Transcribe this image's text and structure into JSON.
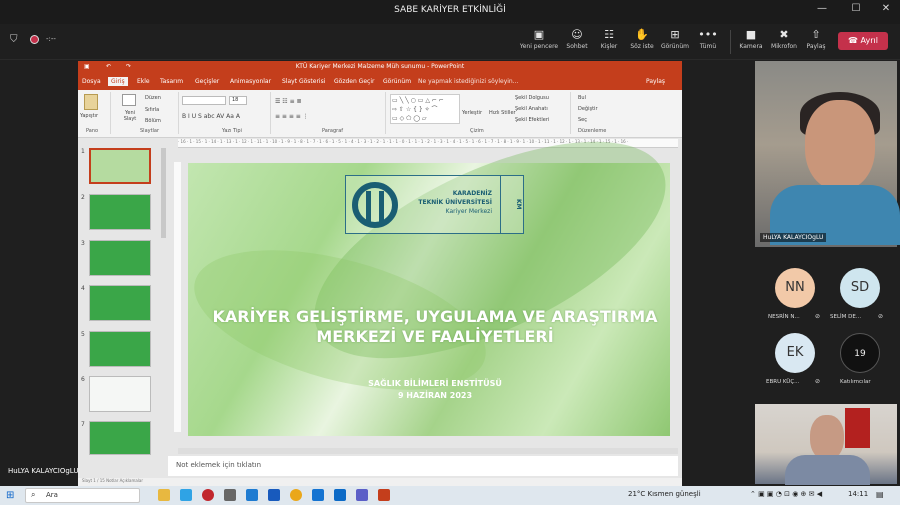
{
  "teams": {
    "window_title": "SABE KARİYER ETKİNLİĞİ",
    "timer": "-:--",
    "toolbar": {
      "new_window": "Yeni pencere",
      "chat": "Sohbet",
      "people": "Kişler",
      "raise": "Söz iste",
      "view": "Görünüm",
      "more": "Tümü",
      "camera": "Kamera",
      "mic": "Mikrofon",
      "share": "Paylaş",
      "leave": "Ayrıl"
    },
    "icons": {
      "new_window": "▣",
      "chat": "☺",
      "people": "☷",
      "raise": "✋",
      "view": "⊞",
      "more": "•••",
      "camera": "■",
      "mic": "✖",
      "share": "⇧",
      "phone": "☎"
    },
    "presenter_label": "HuLYA KALAYCIOgLU"
  },
  "powerpoint": {
    "title": "KTÜ Kariyer Merkezi Malzeme Müh sunumu - PowerPoint",
    "tabs": [
      "Dosya",
      "Giriş",
      "Ekle",
      "Tasarım",
      "Geçişler",
      "Animasyonlar",
      "Slayt Gösterisi",
      "Gözden Geçir",
      "Görünüm"
    ],
    "tell_me": "Ne yapmak istediğinizi söyleyin...",
    "share": "Paylaş",
    "ribbon": {
      "paste": "Yapıştır",
      "new_slide": "Yeni Slayt",
      "layout": "Düzen",
      "reset": "Sıfırla",
      "section": "Bölüm",
      "font_size": "18",
      "arrange": "Yerleştir",
      "quick_styles": "Hızlı Stiller",
      "shape_fill": "Şekil Dolgusu",
      "shape_outline": "Şekil Anahatı",
      "shape_effects": "Şekil Efektleri",
      "find": "Bul",
      "replace": "Değiştir",
      "select": "Seç",
      "groups": [
        "Pano",
        "Slaytlar",
        "Yazı Tipi",
        "Paragraf",
        "Çizim",
        "Düzenleme"
      ]
    },
    "ruler": "· 16 · 1 · 15 · 1 · 14 · 1 · 13 · 1 · 12 · 1 · 11 · 1 · 10 · 1 · 9 · 1 · 8 · 1 · 7 · 1 · 6 · 1 · 5 · 1 · 4 · 1 · 3 · 1 · 2 · 1 · 1 · 1 · 0 · 1 · 1 · 1 · 2 · 1 · 3 · 1 · 4 · 1 · 5 · 1 · 6 · 1 · 7 · 1 · 8 · 1 · 9 · 1 · 10 · 1 · 11 · 1 · 12 · 1 · 13 · 1 · 14 · 1 · 15 · 1 · 16 ·",
    "thumbnails": [
      "1",
      "2",
      "3",
      "4",
      "5",
      "6",
      "7"
    ],
    "slide": {
      "logo_line1": "KARADENİZ",
      "logo_line2": "TEKNİK ÜNİVERSİTESİ",
      "logo_line3": "Kariyer Merkezi",
      "logo_vertical": "KM",
      "title_line1": "KARİYER GELİŞTİRME, UYGULAMA VE ARAŞTIRMA",
      "title_line2": "MERKEZİ VE FAALİYETLERİ",
      "subtitle_line1": "SAĞLIK BİLİMLERİ ENSTİTÜSÜ",
      "subtitle_line2": "9 HAZİRAN 2023"
    },
    "notes": "Not eklemek için tıklatın",
    "status": "Slayt 1 / 15        Notlar        Açıklamalar"
  },
  "participants": {
    "main_name": "HuLYA KALAYCIOgLU",
    "list": [
      {
        "initials": "NN",
        "name": "NESRİN N...",
        "color": "#f2c9a8"
      },
      {
        "initials": "SD",
        "name": "SELİM DE...",
        "color": "#cfe6ef"
      },
      {
        "initials": "EK",
        "name": "EBRU KÜÇ...",
        "color": "#d9e8f2"
      },
      {
        "initials": "19",
        "name": "Katılımcılar",
        "color": "#111111"
      }
    ]
  },
  "taskbar": {
    "search": "Ara",
    "weather": "21°C  Kısmen güneşli",
    "time": "14:11"
  }
}
